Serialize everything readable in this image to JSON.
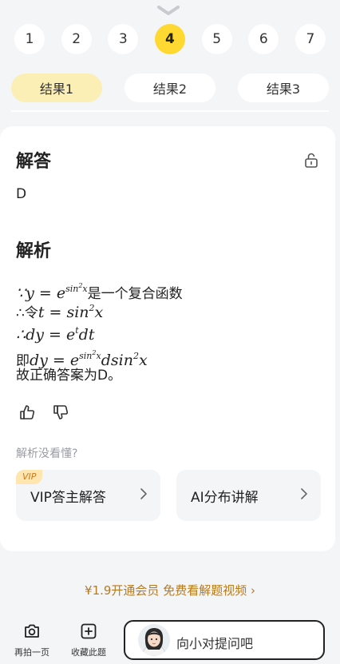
{
  "pages": [
    "1",
    "2",
    "3",
    "4",
    "5",
    "6",
    "7"
  ],
  "active_page": "4",
  "result_tabs": [
    "结果1",
    "结果2",
    "结果3"
  ],
  "active_tab": "结果1",
  "answer": {
    "title": "解答",
    "value": "D"
  },
  "analysis": {
    "title": "解析",
    "line1_suffix": "是一个复合函数",
    "line2_prefix": "∴令",
    "line4_prefix": "即",
    "line5": "故正确答案为D。"
  },
  "help_prompt": "解析没看懂?",
  "options": {
    "vip_badge": "VIP",
    "vip_label": "VIP答主解答",
    "ai_label": "AI分布讲解"
  },
  "promo": "¥1.9开通会员 免费看解题视频 ›",
  "bottom_bar": {
    "retake_label": "再拍一页",
    "collect_label": "收藏此题",
    "ask_placeholder": "向小对提问吧"
  },
  "colors": {
    "accent_yellow": "#ffd932",
    "tab_active_bg": "#fbefb6",
    "promo_text": "#b87a1e"
  },
  "icons": [
    "collapse-chevron-icon",
    "unlock-icon",
    "thumbs-up-icon",
    "thumbs-down-icon",
    "chevron-right-icon",
    "camera-icon",
    "add-square-icon",
    "assistant-avatar"
  ]
}
